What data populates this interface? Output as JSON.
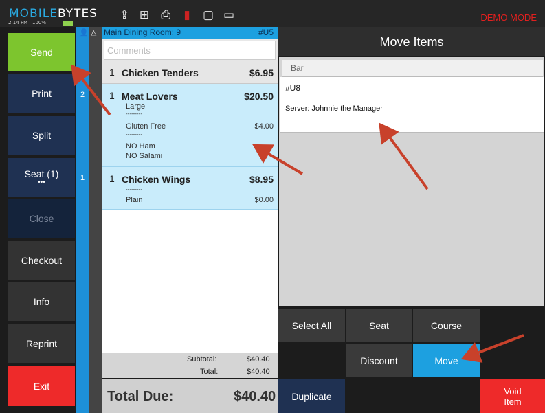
{
  "header": {
    "brand_part1": "MOBILE",
    "brand_part2": "BYTES",
    "status": "2:14 PM | 100%",
    "demo_mode": "DEMO MODE",
    "icons": [
      "cloud-upload-icon",
      "network-icon",
      "printer-icon",
      "manager-icon",
      "chat-icon",
      "monitor-icon"
    ]
  },
  "sidebar": {
    "buttons": [
      {
        "label": "Send",
        "color": "#7dc52e"
      },
      {
        "label": "Print",
        "color": "#1f3152"
      },
      {
        "label": "Split",
        "color": "#1f3152"
      },
      {
        "label": "Seat (1)",
        "sublabel": "•••",
        "color": "#1f3152"
      },
      {
        "label": "Close",
        "color": "#14233b"
      },
      {
        "label": "Checkout",
        "color": "#333333"
      },
      {
        "label": "Info",
        "color": "#333333"
      },
      {
        "label": "Reprint",
        "color": "#333333"
      },
      {
        "label": "Exit",
        "color": "#ee2a2a"
      }
    ]
  },
  "seat_strip": {
    "labels": [
      "1",
      "2",
      "1"
    ]
  },
  "order": {
    "room": "Main Dining Room: 9",
    "number": "#U5",
    "comments_placeholder": "Comments",
    "items": [
      {
        "qty": "1",
        "name": "Chicken Tenders",
        "price": "$6.95",
        "mods": []
      },
      {
        "qty": "1",
        "name": "Meat Lovers",
        "price": "$20.50",
        "mods": [
          {
            "text": "Large",
            "price": ""
          },
          {
            "text": "---------",
            "price": ""
          },
          {
            "text": "Gluten Free",
            "price": "$4.00"
          },
          {
            "text": "---------",
            "price": ""
          },
          {
            "text": "NO Ham",
            "price": ""
          },
          {
            "text": "NO Salami",
            "price": ""
          }
        ]
      },
      {
        "qty": "1",
        "name": "Chicken Wings",
        "price": "$8.95",
        "mods": [
          {
            "text": "---------",
            "price": ""
          },
          {
            "text": "Plain",
            "price": "$0.00"
          }
        ]
      }
    ],
    "subtotal_label": "Subtotal:",
    "subtotal_value": "$40.40",
    "total_label": "Total:",
    "total_value": "$40.40",
    "total_due_label": "Total Due:",
    "total_due_value": "$40.40"
  },
  "move_panel": {
    "title": "Move Items",
    "tab": "Bar",
    "target_number": "#U8",
    "target_server": "Server: Johnnie the Manager"
  },
  "actions": {
    "select_all": "Select All",
    "seat": "Seat",
    "course": "Course",
    "discount": "Discount",
    "move": "Move",
    "duplicate": "Duplicate",
    "void_item": "Void Item"
  },
  "colors": {
    "accent_blue": "#1da0e0",
    "send_green": "#7dc52e",
    "exit_red": "#ee2a2a",
    "arrow": "#c8412b"
  }
}
